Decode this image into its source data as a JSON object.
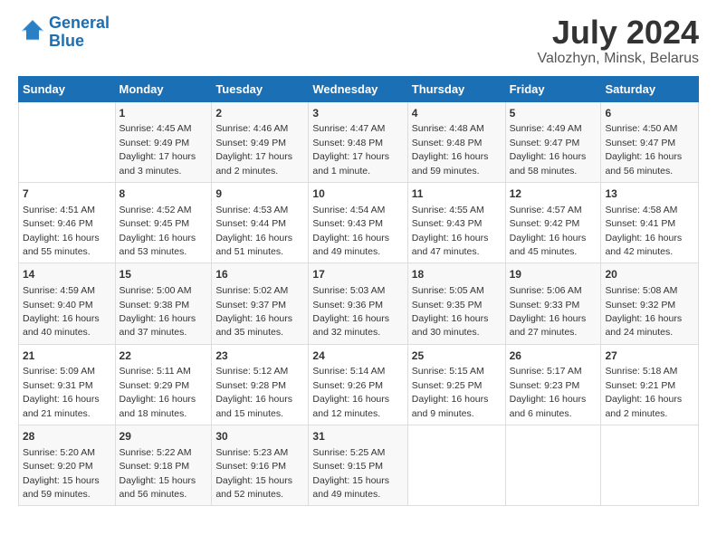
{
  "header": {
    "logo_line1": "General",
    "logo_line2": "Blue",
    "title": "July 2024",
    "subtitle": "Valozhyn, Minsk, Belarus"
  },
  "days_of_week": [
    "Sunday",
    "Monday",
    "Tuesday",
    "Wednesday",
    "Thursday",
    "Friday",
    "Saturday"
  ],
  "weeks": [
    [
      {
        "day": "",
        "info": ""
      },
      {
        "day": "1",
        "info": "Sunrise: 4:45 AM\nSunset: 9:49 PM\nDaylight: 17 hours\nand 3 minutes."
      },
      {
        "day": "2",
        "info": "Sunrise: 4:46 AM\nSunset: 9:49 PM\nDaylight: 17 hours\nand 2 minutes."
      },
      {
        "day": "3",
        "info": "Sunrise: 4:47 AM\nSunset: 9:48 PM\nDaylight: 17 hours\nand 1 minute."
      },
      {
        "day": "4",
        "info": "Sunrise: 4:48 AM\nSunset: 9:48 PM\nDaylight: 16 hours\nand 59 minutes."
      },
      {
        "day": "5",
        "info": "Sunrise: 4:49 AM\nSunset: 9:47 PM\nDaylight: 16 hours\nand 58 minutes."
      },
      {
        "day": "6",
        "info": "Sunrise: 4:50 AM\nSunset: 9:47 PM\nDaylight: 16 hours\nand 56 minutes."
      }
    ],
    [
      {
        "day": "7",
        "info": "Sunrise: 4:51 AM\nSunset: 9:46 PM\nDaylight: 16 hours\nand 55 minutes."
      },
      {
        "day": "8",
        "info": "Sunrise: 4:52 AM\nSunset: 9:45 PM\nDaylight: 16 hours\nand 53 minutes."
      },
      {
        "day": "9",
        "info": "Sunrise: 4:53 AM\nSunset: 9:44 PM\nDaylight: 16 hours\nand 51 minutes."
      },
      {
        "day": "10",
        "info": "Sunrise: 4:54 AM\nSunset: 9:43 PM\nDaylight: 16 hours\nand 49 minutes."
      },
      {
        "day": "11",
        "info": "Sunrise: 4:55 AM\nSunset: 9:43 PM\nDaylight: 16 hours\nand 47 minutes."
      },
      {
        "day": "12",
        "info": "Sunrise: 4:57 AM\nSunset: 9:42 PM\nDaylight: 16 hours\nand 45 minutes."
      },
      {
        "day": "13",
        "info": "Sunrise: 4:58 AM\nSunset: 9:41 PM\nDaylight: 16 hours\nand 42 minutes."
      }
    ],
    [
      {
        "day": "14",
        "info": "Sunrise: 4:59 AM\nSunset: 9:40 PM\nDaylight: 16 hours\nand 40 minutes."
      },
      {
        "day": "15",
        "info": "Sunrise: 5:00 AM\nSunset: 9:38 PM\nDaylight: 16 hours\nand 37 minutes."
      },
      {
        "day": "16",
        "info": "Sunrise: 5:02 AM\nSunset: 9:37 PM\nDaylight: 16 hours\nand 35 minutes."
      },
      {
        "day": "17",
        "info": "Sunrise: 5:03 AM\nSunset: 9:36 PM\nDaylight: 16 hours\nand 32 minutes."
      },
      {
        "day": "18",
        "info": "Sunrise: 5:05 AM\nSunset: 9:35 PM\nDaylight: 16 hours\nand 30 minutes."
      },
      {
        "day": "19",
        "info": "Sunrise: 5:06 AM\nSunset: 9:33 PM\nDaylight: 16 hours\nand 27 minutes."
      },
      {
        "day": "20",
        "info": "Sunrise: 5:08 AM\nSunset: 9:32 PM\nDaylight: 16 hours\nand 24 minutes."
      }
    ],
    [
      {
        "day": "21",
        "info": "Sunrise: 5:09 AM\nSunset: 9:31 PM\nDaylight: 16 hours\nand 21 minutes."
      },
      {
        "day": "22",
        "info": "Sunrise: 5:11 AM\nSunset: 9:29 PM\nDaylight: 16 hours\nand 18 minutes."
      },
      {
        "day": "23",
        "info": "Sunrise: 5:12 AM\nSunset: 9:28 PM\nDaylight: 16 hours\nand 15 minutes."
      },
      {
        "day": "24",
        "info": "Sunrise: 5:14 AM\nSunset: 9:26 PM\nDaylight: 16 hours\nand 12 minutes."
      },
      {
        "day": "25",
        "info": "Sunrise: 5:15 AM\nSunset: 9:25 PM\nDaylight: 16 hours\nand 9 minutes."
      },
      {
        "day": "26",
        "info": "Sunrise: 5:17 AM\nSunset: 9:23 PM\nDaylight: 16 hours\nand 6 minutes."
      },
      {
        "day": "27",
        "info": "Sunrise: 5:18 AM\nSunset: 9:21 PM\nDaylight: 16 hours\nand 2 minutes."
      }
    ],
    [
      {
        "day": "28",
        "info": "Sunrise: 5:20 AM\nSunset: 9:20 PM\nDaylight: 15 hours\nand 59 minutes."
      },
      {
        "day": "29",
        "info": "Sunrise: 5:22 AM\nSunset: 9:18 PM\nDaylight: 15 hours\nand 56 minutes."
      },
      {
        "day": "30",
        "info": "Sunrise: 5:23 AM\nSunset: 9:16 PM\nDaylight: 15 hours\nand 52 minutes."
      },
      {
        "day": "31",
        "info": "Sunrise: 5:25 AM\nSunset: 9:15 PM\nDaylight: 15 hours\nand 49 minutes."
      },
      {
        "day": "",
        "info": ""
      },
      {
        "day": "",
        "info": ""
      },
      {
        "day": "",
        "info": ""
      }
    ]
  ]
}
